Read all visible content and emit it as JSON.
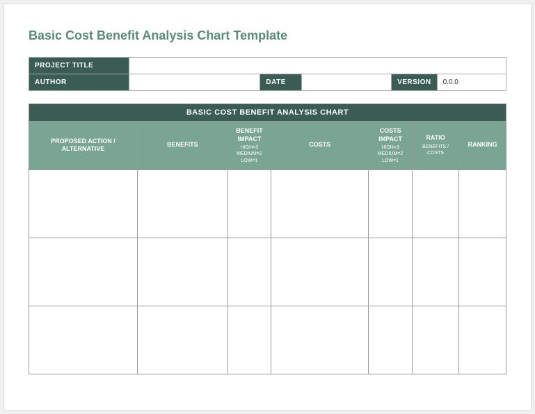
{
  "title": "Basic Cost Benefit Analysis Chart Template",
  "meta": {
    "projectTitleLabel": "PROJECT TITLE",
    "projectTitleValue": "",
    "authorLabel": "AUTHOR",
    "authorValue": "",
    "dateLabel": "DATE",
    "dateValue": "",
    "versionLabel": "VERSION",
    "versionValue": "0.0.0"
  },
  "chart": {
    "heading": "BASIC COST BENEFIT ANALYSIS CHART",
    "headers": {
      "action": "PROPOSED ACTION / ALTERNATIVE",
      "benefits": "BENEFITS",
      "benefitImpact": "BENEFIT IMPACT",
      "benefitImpactSub": "HIGH=3 MEDIUM=2 LOW=1",
      "costs": "COSTS",
      "costsImpact": "COSTS IMPACT",
      "costsImpactSub": "HIGH=3 MEDIUM=2 LOW=1",
      "ratio": "RATIO",
      "ratioSub": "BENEFITS / COSTS",
      "ranking": "RANKING"
    },
    "rows": [
      {
        "action": "",
        "benefits": "",
        "benefitImpact": "",
        "costs": "",
        "costsImpact": "",
        "ratio": "",
        "ranking": ""
      },
      {
        "action": "",
        "benefits": "",
        "benefitImpact": "",
        "costs": "",
        "costsImpact": "",
        "ratio": "",
        "ranking": ""
      },
      {
        "action": "",
        "benefits": "",
        "benefitImpact": "",
        "costs": "",
        "costsImpact": "",
        "ratio": "",
        "ranking": ""
      }
    ]
  }
}
